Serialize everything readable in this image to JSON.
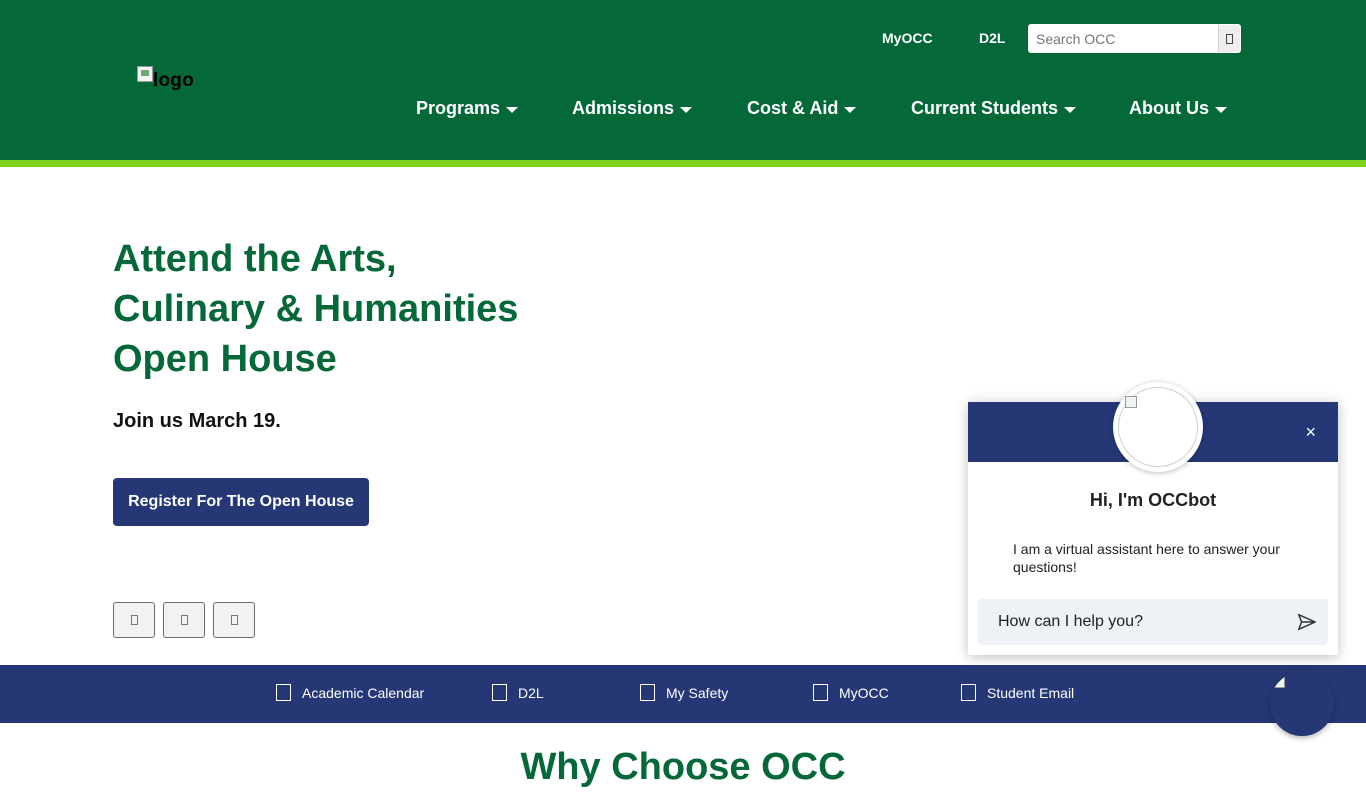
{
  "header": {
    "logo_alt": "logo",
    "util_links": [
      "MyOCC",
      "D2L"
    ],
    "search": {
      "placeholder": "Search OCC",
      "button_icon": "search-icon"
    },
    "nav": [
      "Programs",
      "Admissions",
      "Cost & Aid",
      "Current Students",
      "About Us"
    ],
    "brand_color": "#056839",
    "stripe_color": "#7ed321"
  },
  "hero": {
    "title_lines": [
      "Attend the Arts,",
      "Culinary & Humanities",
      "Open House"
    ],
    "subtitle": "Join us March 19.",
    "cta_label": "Register For The Open House",
    "slide_controls": [
      "previous-slide-icon",
      "pause-slide-icon",
      "next-slide-icon"
    ]
  },
  "quick_links": [
    "Academic Calendar",
    "D2L",
    "My Safety",
    "MyOCC",
    "Student Email"
  ],
  "why_heading": "Why Choose OCC",
  "chat": {
    "close_label": "×",
    "title": "Hi, I'm OCCbot",
    "message": "I am a virtual assistant here to answer your questions!",
    "input_placeholder": "How can I help you?",
    "accent_color": "#263775"
  }
}
